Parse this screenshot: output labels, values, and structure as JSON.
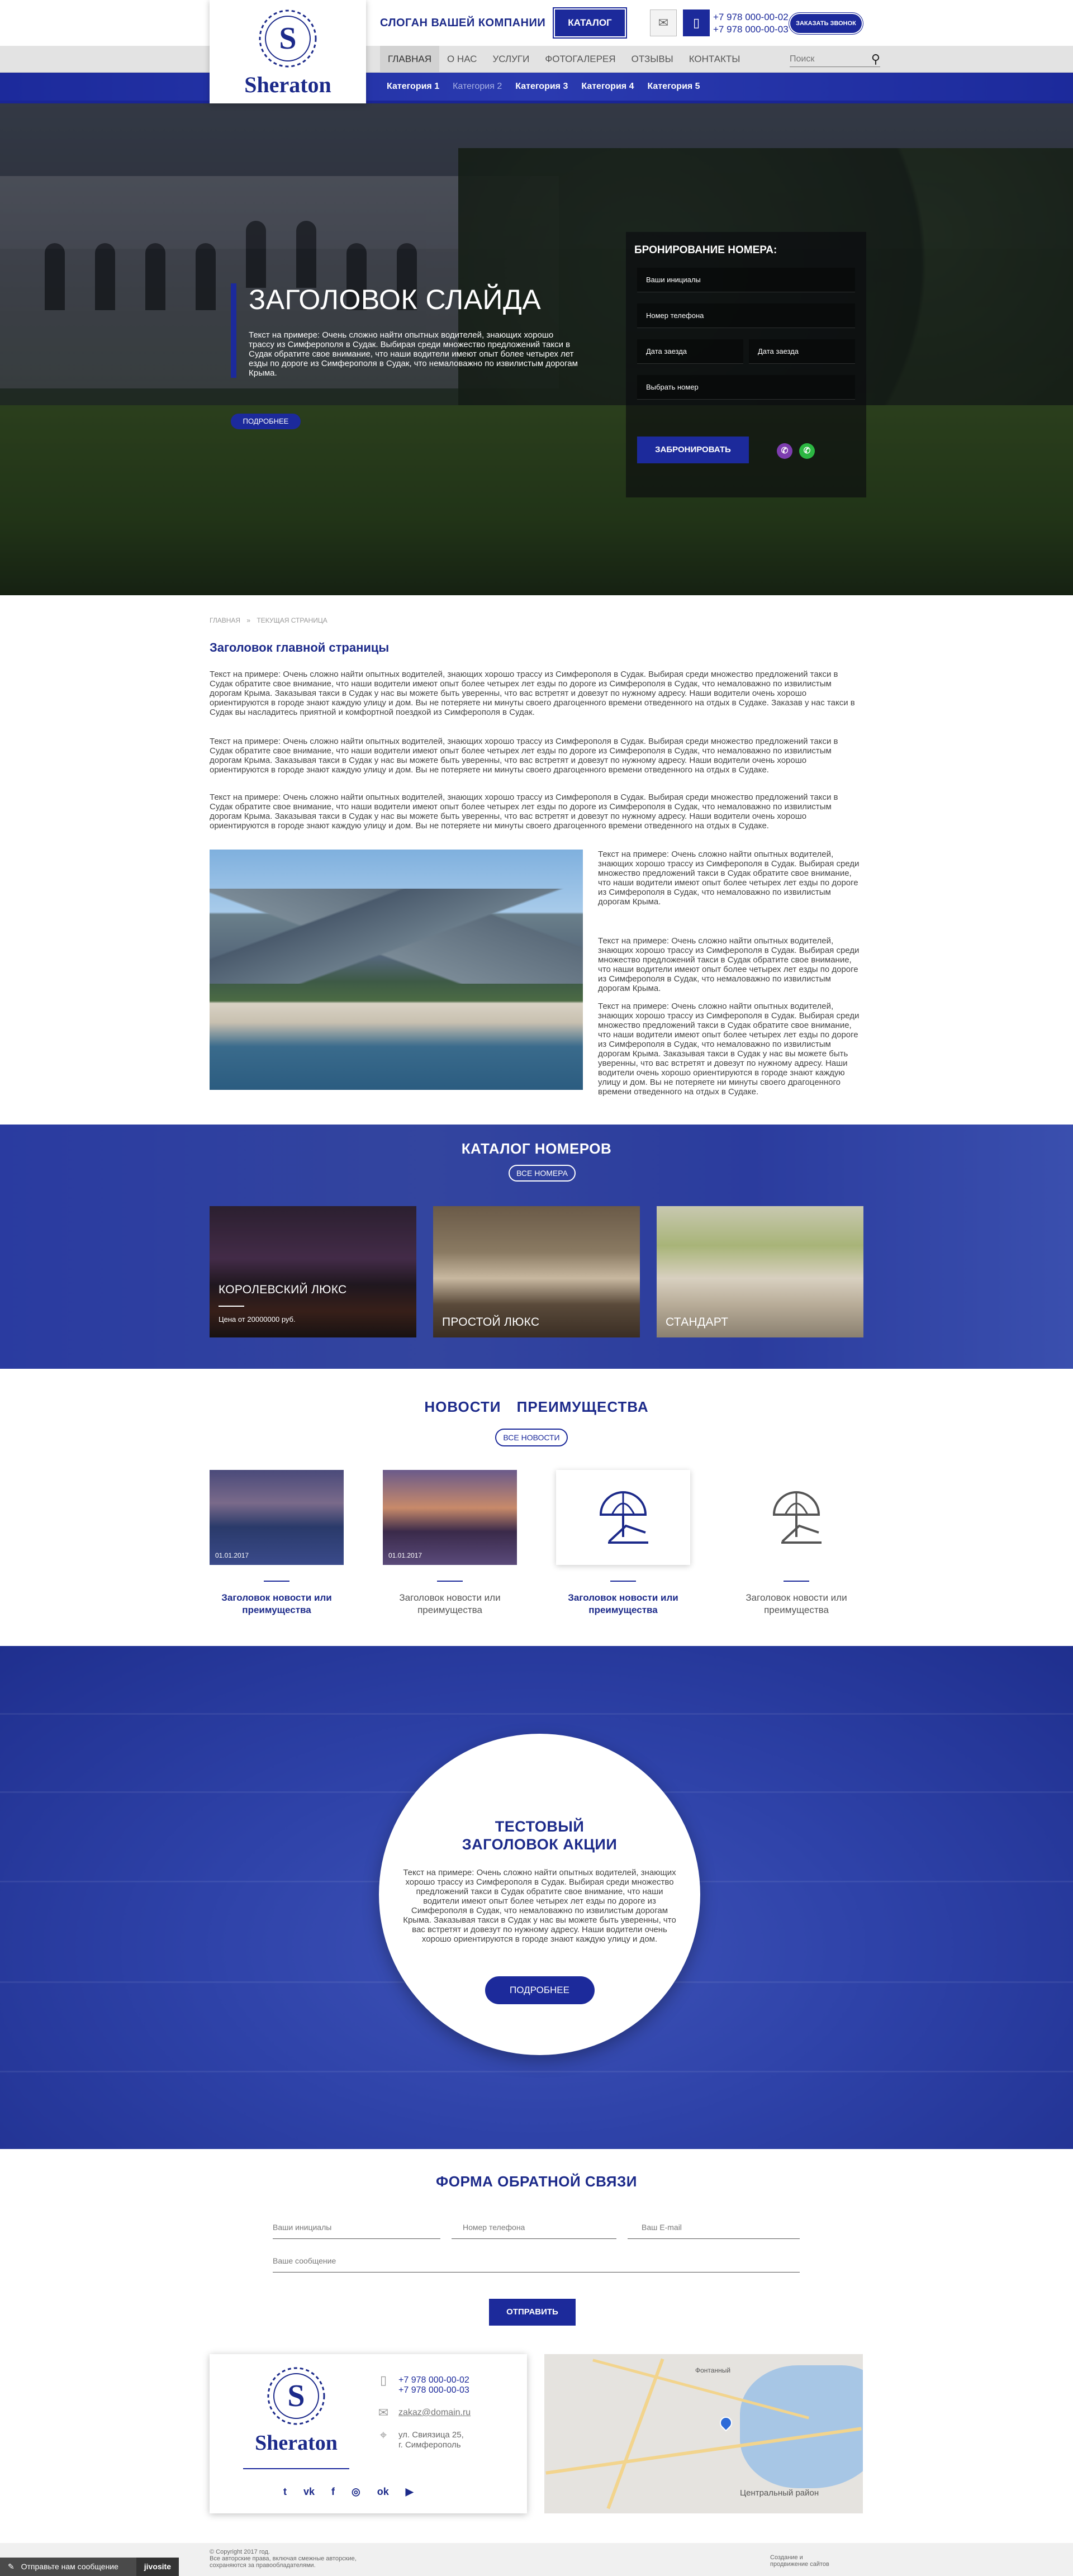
{
  "brand": {
    "name": "Sheraton",
    "slogan": "СЛОГАН ВАШЕЙ КОМПАНИИ",
    "catalog_button": "КАТАЛОГ",
    "call_button": "ЗАКАЗАТЬ ЗВОНОК"
  },
  "phones": [
    "+7 978 000-00-02",
    "+7 978 000-00-03"
  ],
  "nav": [
    {
      "label": "ГЛАВНАЯ",
      "active": true
    },
    {
      "label": "О НАС"
    },
    {
      "label": "УСЛУГИ"
    },
    {
      "label": "ФОТОГАЛЕРЕЯ"
    },
    {
      "label": "ОТЗЫВЫ"
    },
    {
      "label": "КОНТАКТЫ"
    }
  ],
  "search": {
    "placeholder": "Поиск"
  },
  "categories": [
    "Категория 1",
    "Категория 2",
    "Категория 3",
    "Категория 4",
    "Категория 5"
  ],
  "hero": {
    "title": "ЗАГОЛОВОК СЛАЙДА",
    "text": "Текст на примере: Очень сложно найти опытных водителей, знающих хорошо трассу из Симферополя в Судак. Выбирая среди множество предложений такси в Судак обратите свое внимание, что наши водители имеют опыт более четырех лет езды по дороге из Симферополя в Судак, что немаловажно по извилистым дорогам Крыма.",
    "more_button": "ПОДРОБНЕЕ"
  },
  "booking": {
    "title": "БРОНИРОВАНИЕ НОМЕРА:",
    "initials": "Ваши инициалы",
    "phone": "Номер телефона",
    "checkin": "Дата заезда",
    "checkout": "Дата заезда",
    "room": "Выбрать номер",
    "submit": "ЗАБРОНИРОВАТЬ"
  },
  "breadcrumb": [
    "ГЛАВНАЯ",
    "ТЕКУЩАЯ СТРАНИЦА"
  ],
  "page_title": "Заголовок главной страницы",
  "paragraphs": [
    "Текст на примере: Очень сложно найти опытных водителей, знающих хорошо трассу из Симферополя в Судак. Выбирая среди множество предложений такси в Судак обратите свое внимание, что наши водители имеют опыт более четырех лет езды по дороге из Симферополя в Судак, что немаловажно по извилистым дорогам Крыма. Заказывая такси в Судак у нас вы можете быть уверенны, что вас встретят и довезут по нужному адресу. Наши водители очень хорошо ориентируются в городе знают каждую улицу и дом. Вы не потеряете ни минуты своего драгоценного времени отведенного на отдых в Судаке. Заказав у нас такси в Судак вы насладитесь приятной и комфортной поездкой из Симферополя в Судак.",
    "Текст на примере: Очень сложно найти опытных водителей, знающих хорошо трассу из Симферополя в Судак. Выбирая среди множество предложений такси в Судак обратите свое внимание, что наши водители имеют опыт более четырех лет езды по дороге из Симферополя в Судак, что немаловажно по извилистым дорогам Крыма. Заказывая такси в Судак у нас вы можете быть уверенны, что вас встретят и довезут по нужному адресу. Наши водители очень хорошо ориентируются в городе знают каждую улицу и дом. Вы не потеряете ни минуты своего драгоценного времени отведенного на отдых в Судаке.",
    "Текст на примере: Очень сложно найти опытных водителей, знающих хорошо трассу из Симферополя в Судак. Выбирая среди множество предложений такси в Судак обратите свое внимание, что наши водители имеют опыт более четырех лет езды по дороге из Симферополя в Судак, что немаловажно по извилистым дорогам Крыма. Заказывая такси в Судак у нас вы можете быть уверенны, что вас встретят и довезут по нужному адресу. Наши водители очень хорошо ориентируются в городе знают каждую улицу и дом. Вы не потеряете ни минуты своего драгоценного времени отведенного на отдых в Судаке."
  ],
  "side_paragraphs": [
    "Текст на примере: Очень сложно найти опытных водителей, знающих хорошо трассу из Симферополя в Судак. Выбирая среди множество предложений такси в Судак обратите свое внимание, что наши водители имеют опыт более четырех лет езды по дороге из Симферополя в Судак, что немаловажно по извилистым дорогам Крыма.",
    "Текст на примере: Очень сложно найти опытных водителей, знающих хорошо трассу из Симферополя в Судак. Выбирая среди множество предложений такси в Судак обратите свое внимание, что наши водители имеют опыт более четырех лет езды по дороге из Симферополя в Судак, что немаловажно по извилистым дорогам Крыма.",
    "Текст на примере: Очень сложно найти опытных водителей, знающих хорошо трассу из Симферополя в Судак. Выбирая среди множество предложений такси в Судак обратите свое внимание, что наши водители имеют опыт более четырех лет езды по дороге из Симферополя в Судак, что немаловажно по извилистым дорогам Крыма. Заказывая такси в Судак у нас вы можете быть уверенны, что вас встретят и довезут по нужному адресу. Наши водители очень хорошо ориентируются в городе знают каждую улицу и дом. Вы не потеряете ни минуты своего драгоценного времени отведенного на отдых в Судаке."
  ],
  "catalog": {
    "title": "КАТАЛОГ НОМЕРОВ",
    "all_button": "ВСЕ НОМЕРА",
    "rooms": [
      {
        "name": "КОРОЛЕВСКИЙ ЛЮКС",
        "price": "Цена от 20000000 руб."
      },
      {
        "name": "ПРОСТОЙ ЛЮКС"
      },
      {
        "name": "СТАНДАРТ"
      }
    ]
  },
  "news": {
    "tabs": [
      "НОВОСТИ",
      "ПРЕИМУЩЕСТВА"
    ],
    "all_button": "ВСЕ НОВОСТИ",
    "items": [
      {
        "date": "01.01.2017",
        "title": "Заголовок новости или преимущества"
      },
      {
        "date": "01.01.2017",
        "title": "Заголовок новости или преимущества"
      },
      {
        "title": "Заголовок новости или преимущества"
      },
      {
        "title": "Заголовок новости или преимущества"
      }
    ]
  },
  "promo": {
    "title": "ТЕСТОВЫЙ ЗАГОЛОВОК АКЦИИ",
    "text": "Текст на примере: Очень сложно найти опытных водителей, знающих хорошо трассу из Симферополя в Судак. Выбирая среди множество предложений такси в Судак обратите свое внимание, что наши водители имеют опыт более четырех лет езды по дороге из Симферополя в Судак, что немаловажно по извилистым дорогам Крыма. Заказывая такси в Судак у нас вы можете быть уверенны, что вас встретят и довезут по нужному адресу. Наши водители очень хорошо ориентируются в городе знают каждую улицу и дом.",
    "button": "ПОДРОБНЕЕ"
  },
  "feedback": {
    "title": "ФОРМА ОБРАТНОЙ СВЯЗИ",
    "initials": "Ваши инициалы",
    "phone": "Номер телефона",
    "email": "Ваш E-mail",
    "message": "Ваше сообщение",
    "submit": "ОТПРАВИТЬ"
  },
  "contacts": {
    "phones": [
      "+7 978 000-00-02",
      "+7 978 000-00-03"
    ],
    "email": "zakaz@domain.ru",
    "address_line1": "ул. Свиязица 25,",
    "address_line2": "г. Симферополь",
    "socials": [
      "twitter",
      "vk",
      "facebook",
      "instagram",
      "odnoklassniki",
      "youtube"
    ]
  },
  "map": {
    "labels": [
      "Центральный район",
      "Фонтанный"
    ]
  },
  "bottom": {
    "copyright_line1": "© Copyright 2017 год.",
    "copyright_line2": "Все авторские права, включая смежные авторские,",
    "copyright_line3": "сохраняются за правообладателями.",
    "developer_line1": "Создание и",
    "developer_line2": "продвижение сайтов",
    "chat_text": "Отправьте нам сообщение",
    "chat_brand": "jivosite"
  },
  "colors": {
    "primary": "#1c2a9b",
    "dark_text": "#1c2a8a"
  }
}
